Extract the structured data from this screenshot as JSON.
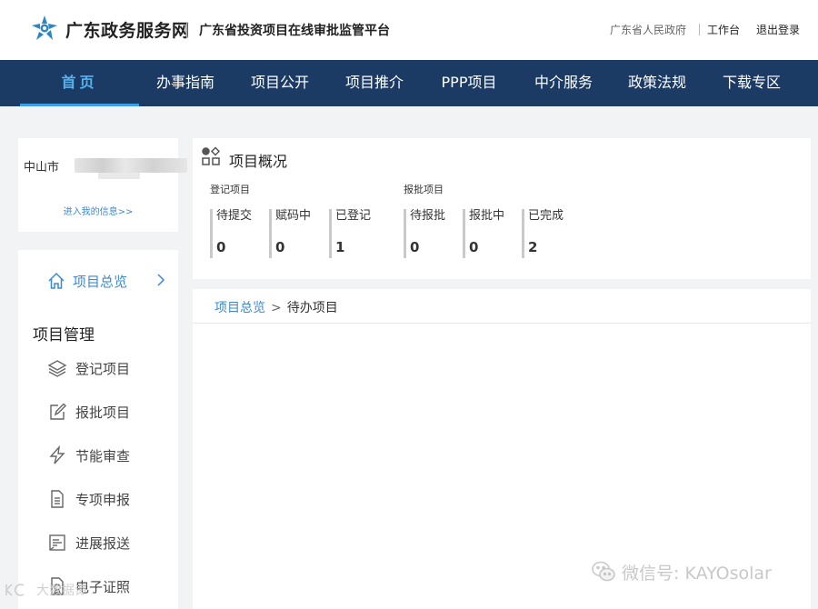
{
  "header": {
    "site_name": "广东政务服务网",
    "platform_name": "广东省投资项目在线审批监管平台",
    "links": {
      "gov": "广东省人民政府",
      "workbench": "工作台",
      "logout": "退出登录"
    }
  },
  "nav": {
    "items": [
      {
        "label": "首页",
        "active": true
      },
      {
        "label": "办事指南"
      },
      {
        "label": "项目公开"
      },
      {
        "label": "项目推介"
      },
      {
        "label": "PPP项目"
      },
      {
        "label": "中介服务"
      },
      {
        "label": "政策法规"
      },
      {
        "label": "下载专区"
      }
    ]
  },
  "user_card": {
    "name_prefix": "中山市",
    "my_info_link": "进入我的信息>>"
  },
  "side_menu": {
    "overview": {
      "label": "项目总览",
      "icon": "home-icon"
    },
    "group_title": "项目管理",
    "items": [
      {
        "label": "登记项目",
        "icon": "layers-icon"
      },
      {
        "label": "报批项目",
        "icon": "edit-icon"
      },
      {
        "label": "节能审查",
        "icon": "lightning-icon"
      },
      {
        "label": "专项申报",
        "icon": "document-icon"
      },
      {
        "label": "进展报送",
        "icon": "report-icon"
      },
      {
        "label": "电子证照",
        "icon": "certificate-icon"
      }
    ]
  },
  "overview": {
    "title": "项目概况",
    "groups": [
      {
        "label": "登记项目",
        "stats": [
          {
            "label": "待提交",
            "value": "0"
          },
          {
            "label": "赋码中",
            "value": "0"
          },
          {
            "label": "已登记",
            "value": "1"
          }
        ]
      },
      {
        "label": "报批项目",
        "stats": [
          {
            "label": "待报批",
            "value": "0"
          },
          {
            "label": "报批中",
            "value": "0"
          },
          {
            "label": "已完成",
            "value": "2"
          }
        ]
      }
    ]
  },
  "breadcrumb": {
    "link": "项目总览",
    "separator": ">",
    "current": "待办项目"
  },
  "watermark": {
    "right": "微信号: KAYOsolar",
    "left": "大数据谭"
  },
  "colors": {
    "nav_bg": "#1c3b64",
    "accent": "#3c8ad1",
    "active_nav": "#57b2f0"
  }
}
